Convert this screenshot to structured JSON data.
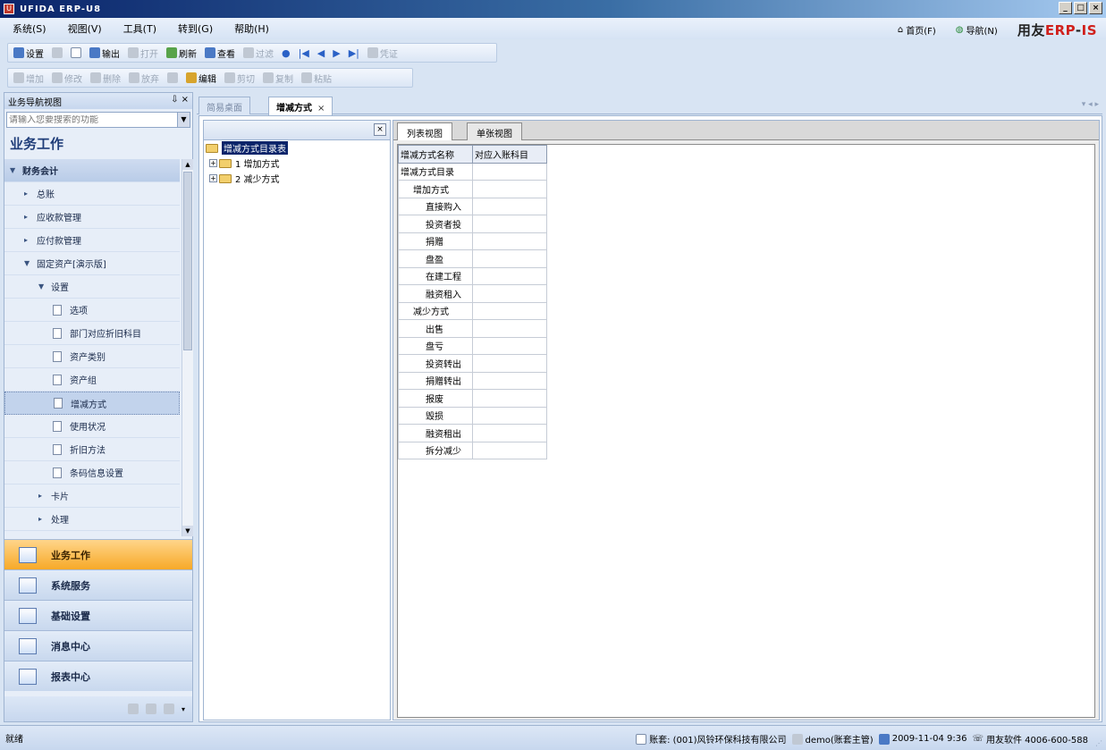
{
  "window": {
    "title": "UFIDA ERP-U8",
    "min": "_",
    "max": "□",
    "close": "×"
  },
  "menu": {
    "items": [
      "系统(S)",
      "视图(V)",
      "工具(T)",
      "转到(G)",
      "帮助(H)"
    ]
  },
  "top_right": {
    "home": "首页(F)",
    "nav": "导航(N)",
    "brand_prefix": "用友",
    "brand_erp": "ERP",
    "brand_dash": "-",
    "brand_ls": "IS"
  },
  "toolbar1": [
    "设置",
    "",
    "",
    "输出",
    "打开",
    "刷新",
    "查看",
    "过滤",
    "",
    "",
    "",
    "",
    "",
    "凭证"
  ],
  "toolbar2": [
    "增加",
    "修改",
    "删除",
    "放弃",
    "",
    "编辑",
    "剪切",
    "复制",
    "粘贴"
  ],
  "nav_panel": {
    "header": "业务导航视图",
    "pin": "⇩ ×",
    "search_placeholder": "请输入您要搜索的功能",
    "section_title": "业务工作",
    "items": [
      {
        "label": "财务会计",
        "level": 0,
        "type": "cat"
      },
      {
        "label": "总账",
        "level": 1
      },
      {
        "label": "应收款管理",
        "level": 1
      },
      {
        "label": "应付款管理",
        "level": 1
      },
      {
        "label": "固定资产[演示版]",
        "level": 1
      },
      {
        "label": "设置",
        "level": 2
      },
      {
        "label": "选项",
        "level": 3
      },
      {
        "label": "部门对应折旧科目",
        "level": 3
      },
      {
        "label": "资产类别",
        "level": 3
      },
      {
        "label": "资产组",
        "level": 3
      },
      {
        "label": "增减方式",
        "level": 3,
        "selected": true
      },
      {
        "label": "使用状况",
        "level": 3
      },
      {
        "label": "折旧方法",
        "level": 3
      },
      {
        "label": "条码信息设置",
        "level": 3
      },
      {
        "label": "卡片",
        "level": 2
      },
      {
        "label": "处理",
        "level": 2
      }
    ],
    "big_buttons": [
      "业务工作",
      "系统服务",
      "基础设置",
      "消息中心",
      "报表中心"
    ]
  },
  "tabs": [
    "简易桌面",
    "增减方式"
  ],
  "tree": {
    "root": "增减方式目录表",
    "children": [
      "1 增加方式",
      "2 减少方式"
    ]
  },
  "view_tabs": [
    "列表视图",
    "单张视图"
  ],
  "grid": {
    "headers": [
      "增减方式名称",
      "对应入账科目"
    ],
    "rows": [
      {
        "name": "增减方式目录",
        "indent": 0
      },
      {
        "name": "增加方式",
        "indent": 1
      },
      {
        "name": "直接购入",
        "indent": 2
      },
      {
        "name": "投资者投",
        "indent": 2
      },
      {
        "name": "捐赠",
        "indent": 2
      },
      {
        "name": "盘盈",
        "indent": 2
      },
      {
        "name": "在建工程",
        "indent": 2
      },
      {
        "name": "融资租入",
        "indent": 2
      },
      {
        "name": "减少方式",
        "indent": 1
      },
      {
        "name": "出售",
        "indent": 2
      },
      {
        "name": "盘亏",
        "indent": 2
      },
      {
        "name": "投资转出",
        "indent": 2
      },
      {
        "name": "捐赠转出",
        "indent": 2
      },
      {
        "name": "报废",
        "indent": 2
      },
      {
        "name": "毁损",
        "indent": 2
      },
      {
        "name": "融资租出",
        "indent": 2
      },
      {
        "name": "拆分减少",
        "indent": 2
      }
    ]
  },
  "status": {
    "ready": "就绪",
    "account": "账套: (001)风铃环保科技有限公司",
    "user": "demo(账套主管)",
    "date": "2009-11-04 9:36",
    "phone": "用友软件 4006-600-588"
  }
}
